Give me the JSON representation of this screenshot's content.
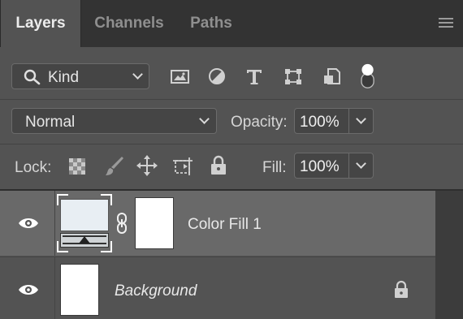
{
  "tabs": [
    {
      "label": "Layers",
      "active": true
    },
    {
      "label": "Channels",
      "active": false
    },
    {
      "label": "Paths",
      "active": false
    }
  ],
  "filter": {
    "kind_label": "Kind",
    "icons": [
      "pixel-layer-filter-icon",
      "adjustment-layer-filter-icon",
      "type-layer-filter-icon",
      "shape-layer-filter-icon",
      "smart-object-filter-icon",
      "filter-toggle-icon"
    ]
  },
  "blend": {
    "mode": "Normal",
    "opacity_label": "Opacity:",
    "opacity_value": "100%"
  },
  "lock": {
    "label": "Lock:",
    "icons": [
      "lock-transparent-pixels-icon",
      "lock-image-pixels-icon",
      "lock-position-icon",
      "lock-artboard-icon",
      "lock-all-icon"
    ],
    "fill_label": "Fill:",
    "fill_value": "100%"
  },
  "layers": [
    {
      "name": "Color Fill 1",
      "visible": true,
      "selected": true,
      "italic": false,
      "locked": false,
      "fill_color": "#e8eef3"
    },
    {
      "name": "Background",
      "visible": true,
      "selected": false,
      "italic": true,
      "locked": true
    }
  ],
  "colors": {
    "panel_bg": "#535353",
    "tabbar_bg": "#333333",
    "selected_layer_bg": "#696969"
  }
}
